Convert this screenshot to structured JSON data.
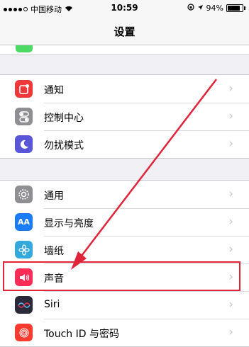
{
  "status_bar": {
    "carrier": "中国移动",
    "time": "10:59",
    "battery_percent": "94%",
    "battery_level": 0.94,
    "signal_icon": "signal-dots-icon",
    "wifi_icon": "wifi-icon",
    "lock_icon": "rotation-lock-icon",
    "location_icon": "location-arrow-icon"
  },
  "nav": {
    "title": "设置"
  },
  "groups": [
    {
      "items": [
        {
          "label": "通知",
          "icon": "notifications-icon",
          "color": "#f0383a"
        },
        {
          "label": "控制中心",
          "icon": "control-center-icon",
          "color": "#8e8e93"
        },
        {
          "label": "勿扰模式",
          "icon": "moon-icon",
          "color": "#5856d6"
        }
      ]
    },
    {
      "items": [
        {
          "label": "通用",
          "icon": "gear-icon",
          "color": "#8e8e93"
        },
        {
          "label": "显示与亮度",
          "icon": "display-icon",
          "color": "#1a7cf7",
          "glyph": "AA"
        },
        {
          "label": "墙纸",
          "icon": "wallpaper-icon",
          "color": "#34aadc"
        },
        {
          "label": "声音",
          "icon": "speaker-icon",
          "color": "#ff2d55"
        },
        {
          "label": "Siri",
          "icon": "siri-icon",
          "color": "#2a2a3a"
        },
        {
          "label": "Touch ID 与密码",
          "icon": "fingerprint-icon",
          "color": "#ff3b30"
        }
      ]
    }
  ],
  "annotation": {
    "highlight_color": "#e0243a"
  }
}
